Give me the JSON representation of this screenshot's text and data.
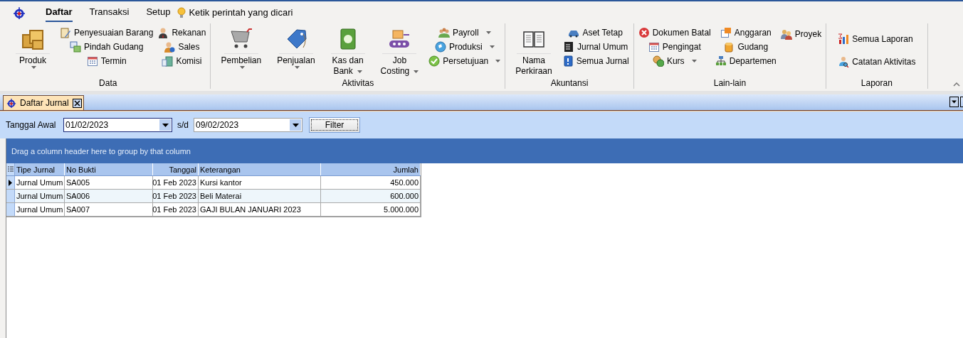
{
  "menu": {
    "tabs": [
      {
        "label": "Daftar",
        "selected": true
      },
      {
        "label": "Transaksi",
        "selected": false
      },
      {
        "label": "Setup",
        "selected": false
      }
    ],
    "search": {
      "placeholder": "Ketik perintah yang dicari"
    }
  },
  "ribbon": {
    "groups": [
      {
        "label": "Data",
        "columns": [
          [
            {
              "kind": "large",
              "lines": [
                "Produk"
              ],
              "dropdown": true
            }
          ],
          [
            {
              "kind": "small",
              "label": "Penyesuaian Barang",
              "dropdown": false
            },
            {
              "kind": "small",
              "label": "Pindah Gudang",
              "dropdown": false
            },
            {
              "kind": "small",
              "label": "Termin",
              "dropdown": false
            }
          ],
          [
            {
              "kind": "small",
              "label": "Rekanan",
              "dropdown": false
            },
            {
              "kind": "small",
              "label": "Sales",
              "dropdown": false
            },
            {
              "kind": "small",
              "label": "Komisi",
              "dropdown": false
            }
          ]
        ]
      },
      {
        "label": "Aktivitas",
        "columns": [
          [
            {
              "kind": "large",
              "lines": [
                "Pembelian"
              ],
              "dropdown": true
            }
          ],
          [
            {
              "kind": "large",
              "lines": [
                "Penjualan"
              ],
              "dropdown": true
            }
          ],
          [
            {
              "kind": "large",
              "lines": [
                "Kas dan",
                "Bank"
              ],
              "dropdown": true
            }
          ],
          [
            {
              "kind": "large",
              "lines": [
                "Job",
                "Costing"
              ],
              "dropdown": true
            }
          ],
          [
            {
              "kind": "small",
              "label": "Payroll",
              "dropdown": true
            },
            {
              "kind": "small",
              "label": "Produksi",
              "dropdown": true
            },
            {
              "kind": "small",
              "label": "Persetujuan",
              "dropdown": true
            }
          ]
        ]
      },
      {
        "label": "Akuntansi",
        "columns": [
          [
            {
              "kind": "large",
              "lines": [
                "Nama",
                "Perkiraan"
              ],
              "dropdown": false
            }
          ],
          [
            {
              "kind": "small",
              "label": "Aset Tetap",
              "dropdown": false
            },
            {
              "kind": "small",
              "label": "Jurnal Umum",
              "dropdown": false
            },
            {
              "kind": "small",
              "label": "Semua Jurnal",
              "dropdown": false
            }
          ]
        ]
      },
      {
        "label": "Lain-lain",
        "columns": [
          [
            {
              "kind": "small",
              "label": "Dokumen Batal",
              "dropdown": false
            },
            {
              "kind": "small",
              "label": "Pengingat",
              "dropdown": false
            },
            {
              "kind": "small",
              "label": "Kurs",
              "dropdown": true
            }
          ],
          [
            {
              "kind": "small",
              "label": "Anggaran",
              "dropdown": false
            },
            {
              "kind": "small",
              "label": "Gudang",
              "dropdown": false
            },
            {
              "kind": "small",
              "label": "Departemen",
              "dropdown": false
            }
          ],
          [
            {
              "kind": "small",
              "label": "Proyek",
              "dropdown": false
            }
          ]
        ]
      },
      {
        "label": "Laporan",
        "columns": [
          [
            {
              "kind": "medium",
              "label": "Semua Laporan",
              "dropdown": false
            },
            {
              "kind": "medium",
              "label": "Catatan Aktivitas",
              "dropdown": false
            }
          ]
        ]
      }
    ]
  },
  "document_tabs": [
    {
      "label": "Daftar Jurnal",
      "selected": true
    }
  ],
  "filter": {
    "start_label": "Tanggal Awal",
    "start_date": "01/02/2023",
    "range_label": "s/d",
    "end_date": "09/02/2023",
    "button": "Filter"
  },
  "grid": {
    "group_hint": "Drag a column header here to group by that column",
    "columns": [
      "Tipe Jurnal",
      "No Bukti",
      "Tanggal",
      "Keterangan",
      "Jumlah"
    ],
    "rows": [
      {
        "cells": [
          "Jurnal Umum",
          "SA005",
          "01 Feb 2023",
          "Kursi kantor",
          "450.000"
        ],
        "selected": true
      },
      {
        "cells": [
          "Jurnal Umum",
          "SA006",
          "01 Feb 2023",
          "Beli Materai",
          "600.000"
        ],
        "selected": false
      },
      {
        "cells": [
          "Jurnal Umum",
          "SA007",
          "01 Feb 2023",
          "GAJI BULAN JANUARI 2023",
          "5.000.000"
        ],
        "selected": false
      }
    ]
  }
}
